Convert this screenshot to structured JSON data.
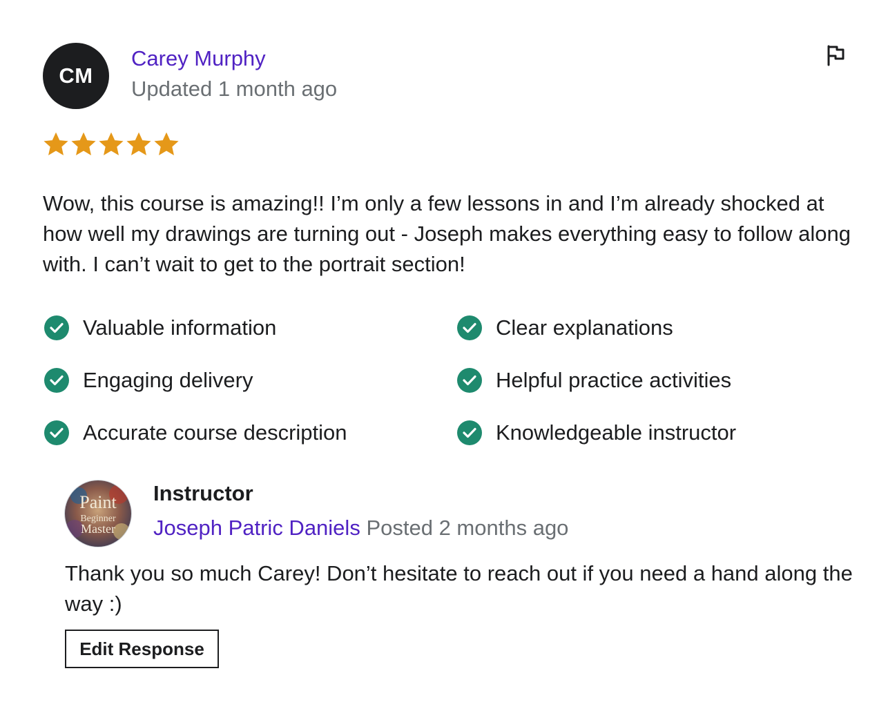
{
  "review": {
    "avatar_initials": "CM",
    "reviewer_name": "Carey Murphy",
    "date_text": "Updated 1 month ago",
    "rating": 5,
    "rating_max": 5,
    "star_color": "#e59819",
    "body": "Wow, this course is amazing!! I’m only a few lessons in and I’m already shocked at how well my drawings are turning out - Joseph makes everything easy to follow along with. I can’t wait to get to the portrait section!",
    "flag_icon": "flag-icon"
  },
  "features": [
    {
      "label": "Valuable information",
      "checked": true
    },
    {
      "label": "Clear explanations",
      "checked": true
    },
    {
      "label": "Engaging delivery",
      "checked": true
    },
    {
      "label": "Helpful practice activities",
      "checked": true
    },
    {
      "label": "Accurate course description",
      "checked": true
    },
    {
      "label": "Knowledgeable instructor",
      "checked": true
    }
  ],
  "response": {
    "heading": "Instructor",
    "instructor_name": "Joseph Patric Daniels",
    "posted_text": "Posted 2 months ago",
    "avatar_text": {
      "line1": "Paint",
      "line2": "Beginner",
      "line3": "Master"
    },
    "body": "Thank you so much Carey! Don’t hesitate to reach out if you need a hand along the way :)",
    "edit_button_label": "Edit Response"
  },
  "colors": {
    "link_purple": "#5022c3",
    "muted_gray": "#6a6f73",
    "check_green": "#1e8a6e",
    "text_dark": "#1c1d1f"
  }
}
